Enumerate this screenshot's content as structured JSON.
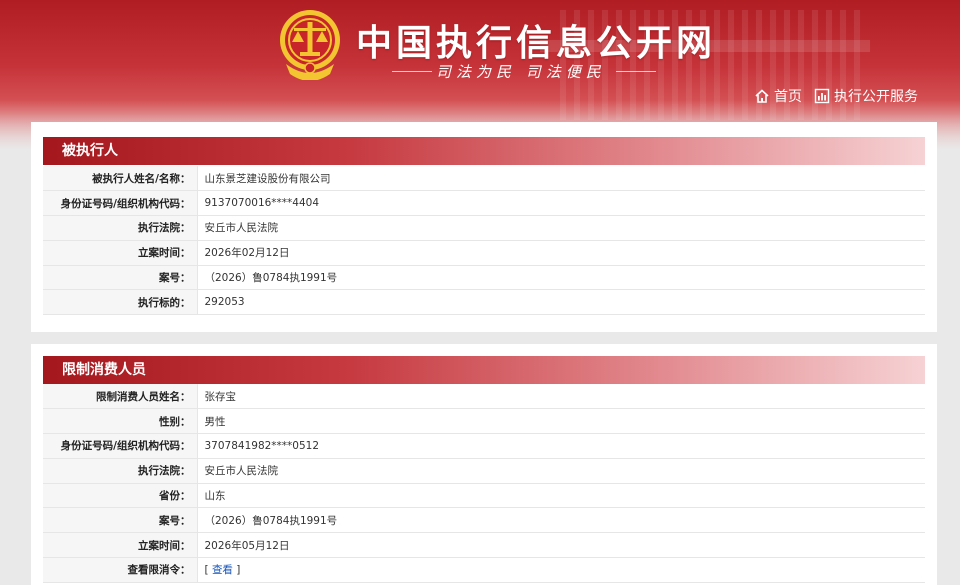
{
  "header": {
    "site_title": "中国执行信息公开网",
    "slogan": "司法为民  司法便民",
    "nav": [
      {
        "label": "首页",
        "icon": "home-icon"
      },
      {
        "label": "执行公开服务",
        "icon": "chart-icon"
      }
    ]
  },
  "colors": {
    "header_red": "#b01e24",
    "section_head": "#a3171d",
    "link_blue": "#1a55b8"
  },
  "section1": {
    "title": "被执行人",
    "rows": [
      {
        "label": "被执行人姓名/名称：",
        "value": "山东景芝建设股份有限公司"
      },
      {
        "label": "身份证号码/组织机构代码：",
        "value": "9137070016****4404"
      },
      {
        "label": "执行法院：",
        "value": "安丘市人民法院"
      },
      {
        "label": "立案时间：",
        "value": "2026年02月12日"
      },
      {
        "label": "案号：",
        "value": "（2026）鲁0784执1991号"
      },
      {
        "label": "执行标的：",
        "value": "292053"
      }
    ]
  },
  "section2": {
    "title": "限制消费人员",
    "rows": [
      {
        "label": "限制消费人员姓名：",
        "value": "张存宝"
      },
      {
        "label": "性别：",
        "value": "男性"
      },
      {
        "label": "身份证号码/组织机构代码：",
        "value": "3707841982****0512"
      },
      {
        "label": "执行法院：",
        "value": "安丘市人民法院"
      },
      {
        "label": "省份：",
        "value": "山东"
      },
      {
        "label": "案号：",
        "value": "（2026）鲁0784执1991号"
      },
      {
        "label": "立案时间：",
        "value": "2026年05月12日"
      },
      {
        "label": "查看限消令：",
        "value_prefix": "[ ",
        "link": "查看",
        "value_suffix": " ]"
      }
    ]
  }
}
